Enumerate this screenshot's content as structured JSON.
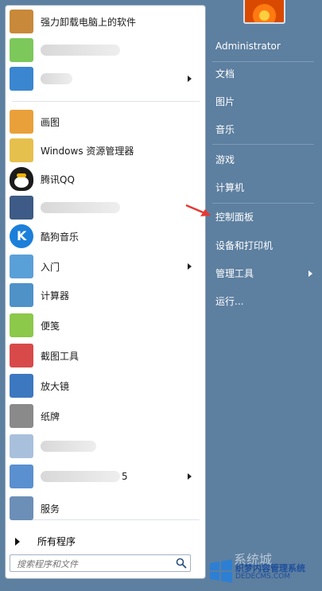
{
  "left_items": [
    {
      "label": "强力卸载电脑上的软件",
      "icon": "uninstall-icon",
      "color": "#c8893a",
      "arrow": false
    },
    {
      "label": "",
      "icon": "blurred-app-icon",
      "color": "#7cc85a",
      "arrow": false
    },
    {
      "label": "",
      "icon": "blurred-app-icon",
      "color": "#3a86d0",
      "arrow": true
    },
    {
      "label": "画图",
      "icon": "paint-icon",
      "color": "#e9a03a",
      "arrow": false
    },
    {
      "label": "Windows 资源管理器",
      "icon": "explorer-folder-icon",
      "color": "#e6c04d",
      "arrow": false
    },
    {
      "label": "腾讯QQ",
      "icon": "qq-penguin-icon",
      "color": "#1b1b1b",
      "arrow": false
    },
    {
      "label": "",
      "icon": "blurred-app-icon",
      "color": "#3d5b86",
      "arrow": false
    },
    {
      "label": "酷狗音乐",
      "icon": "kugou-icon",
      "color": "#1c7fd9",
      "arrow": false
    },
    {
      "label": "入门",
      "icon": "getting-started-icon",
      "color": "#5aa0d8",
      "arrow": true
    },
    {
      "label": "计算器",
      "icon": "calculator-icon",
      "color": "#4e92c8",
      "arrow": false
    },
    {
      "label": "便笺",
      "icon": "sticky-notes-icon",
      "color": "#8cc84a",
      "arrow": false
    },
    {
      "label": "截图工具",
      "icon": "snipping-tool-icon",
      "color": "#d84a4a",
      "arrow": false
    },
    {
      "label": "放大镜",
      "icon": "magnifier-icon",
      "color": "#3c78c0",
      "arrow": false
    },
    {
      "label": "纸牌",
      "icon": "solitaire-icon",
      "color": "#8a8a8a",
      "arrow": false
    },
    {
      "label": "",
      "icon": "blurred-app-icon",
      "color": "#a9c0dc",
      "arrow": false
    },
    {
      "label": "5",
      "icon": "blurred-app-icon",
      "color": "#5a8fd0",
      "arrow": true
    },
    {
      "label": "服务",
      "icon": "services-gear-icon",
      "color": "#6c8fb8",
      "arrow": false
    }
  ],
  "all_programs": "所有程序",
  "search_placeholder": "搜索程序和文件",
  "right_items": [
    {
      "label": "Administrator",
      "arrow": false
    },
    {
      "label": "文档",
      "arrow": false
    },
    {
      "label": "图片",
      "arrow": false
    },
    {
      "label": "音乐",
      "arrow": false
    },
    {
      "label": "游戏",
      "arrow": false
    },
    {
      "label": "计算机",
      "arrow": false
    },
    {
      "label": "控制面板",
      "arrow": false
    },
    {
      "label": "设备和打印机",
      "arrow": false
    },
    {
      "label": "管理工具",
      "arrow": true
    },
    {
      "label": "运行...",
      "arrow": false
    }
  ],
  "watermark": {
    "title": "织梦内容管理系统",
    "sub": "DEDECMS.COM",
    "faint": "系统城"
  },
  "colors": {
    "accent_red": "#e53935",
    "menu_blue": "#5d7fa0"
  }
}
